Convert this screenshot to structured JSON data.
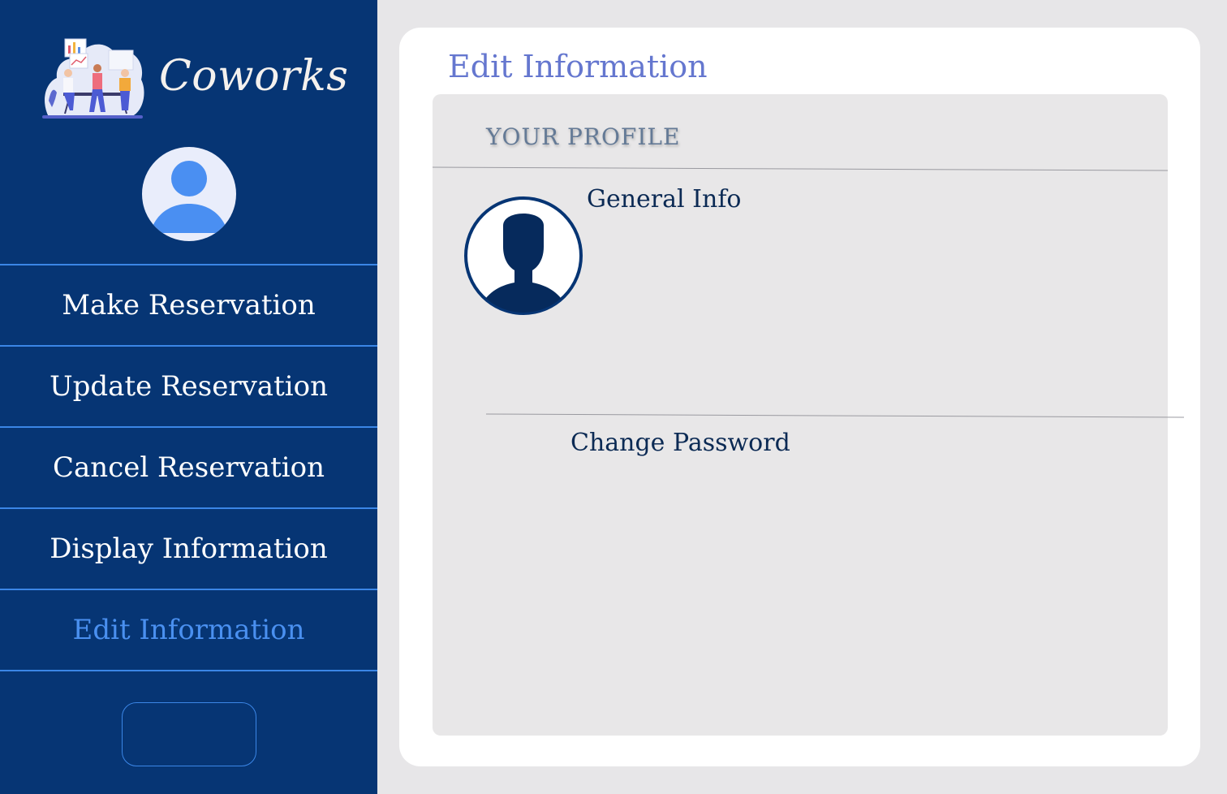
{
  "brand": {
    "name": "Coworks"
  },
  "sidebar": {
    "items": [
      {
        "label": "Make Reservation"
      },
      {
        "label": "Update Reservation"
      },
      {
        "label": "Cancel Reservation"
      },
      {
        "label": "Display Information"
      },
      {
        "label": "Edit Information",
        "active": true
      }
    ],
    "logout_label": ""
  },
  "main": {
    "title": "Edit Information",
    "section_heading": "YOUR PROFILE",
    "general_info_label": "General Info",
    "change_password_label": "Change Password"
  },
  "icons": [
    "coworks-logo-illustration",
    "user-avatar-icon",
    "profile-silhouette-icon"
  ],
  "colors": {
    "sidebar": "#063574",
    "divider": "#3b86e6",
    "active": "#4a90f0",
    "title": "#6577cf",
    "page_bg": "#e7e6e8",
    "panel_bg": "#e8e7e8",
    "text_dark": "#0b2a54"
  }
}
